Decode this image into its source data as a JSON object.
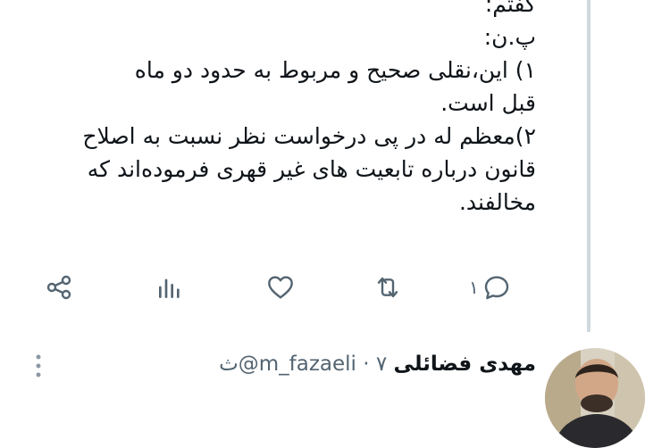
{
  "tweet": {
    "lines": [
      "گفتم:",
      "پ.ن:",
      "۱) این،نقلی صحیح و مربوط به حدود دو ماه",
      "قبل است.",
      "۲)معظم له در پی درخواست نظر نسبت به اصلاح",
      "قانون درباره تابعیت های غیر قهری فرموده‌اند که",
      "مخالفند."
    ]
  },
  "actions": {
    "reply_count": "۱",
    "retweet_icon": "retweet-icon",
    "like_icon": "heart-icon",
    "views_icon": "views-icon",
    "share_icon": "share-icon"
  },
  "next_tweet": {
    "display_name": "مهدی فضائلی",
    "handle": "@m_fazaeli",
    "separator": "·",
    "time": "۷ث"
  },
  "colors": {
    "text": "#0f1419",
    "secondary": "#536471",
    "thread_line": "#cfd9de"
  }
}
